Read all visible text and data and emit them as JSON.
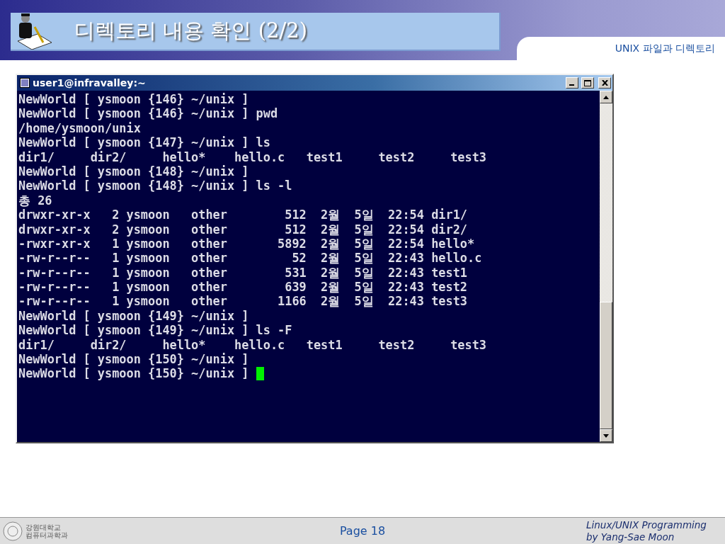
{
  "slide": {
    "title": "디렉토리 내용 확인 (2/2)",
    "section": "UNIX 파일과 디렉토리"
  },
  "terminal": {
    "title": "user1@infravalley:~",
    "lines": [
      "NewWorld [ ysmoon {146} ~/unix ]",
      "NewWorld [ ysmoon {146} ~/unix ] pwd",
      "/home/ysmoon/unix",
      "NewWorld [ ysmoon {147} ~/unix ] ls",
      "dir1/     dir2/     hello*    hello.c   test1     test2     test3",
      "NewWorld [ ysmoon {148} ~/unix ]",
      "NewWorld [ ysmoon {148} ~/unix ] ls -l",
      "총 26",
      "drwxr-xr-x   2 ysmoon   other        512  2월  5일  22:54 dir1/",
      "drwxr-xr-x   2 ysmoon   other        512  2월  5일  22:54 dir2/",
      "-rwxr-xr-x   1 ysmoon   other       5892  2월  5일  22:54 hello*",
      "-rw-r--r--   1 ysmoon   other         52  2월  5일  22:43 hello.c",
      "-rw-r--r--   1 ysmoon   other        531  2월  5일  22:43 test1",
      "-rw-r--r--   1 ysmoon   other        639  2월  5일  22:43 test2",
      "-rw-r--r--   1 ysmoon   other       1166  2월  5일  22:43 test3",
      "NewWorld [ ysmoon {149} ~/unix ]",
      "NewWorld [ ysmoon {149} ~/unix ] ls -F",
      "dir1/     dir2/     hello*    hello.c   test1     test2     test3",
      "NewWorld [ ysmoon {150} ~/unix ]",
      "NewWorld [ ysmoon {150} ~/unix ] "
    ]
  },
  "footer": {
    "logo_text": [
      "강원대학교",
      "컴퓨터과학과"
    ],
    "page": "Page 18",
    "credit": [
      "Linux/UNIX Programming",
      "by Yang-Sae Moon"
    ]
  }
}
